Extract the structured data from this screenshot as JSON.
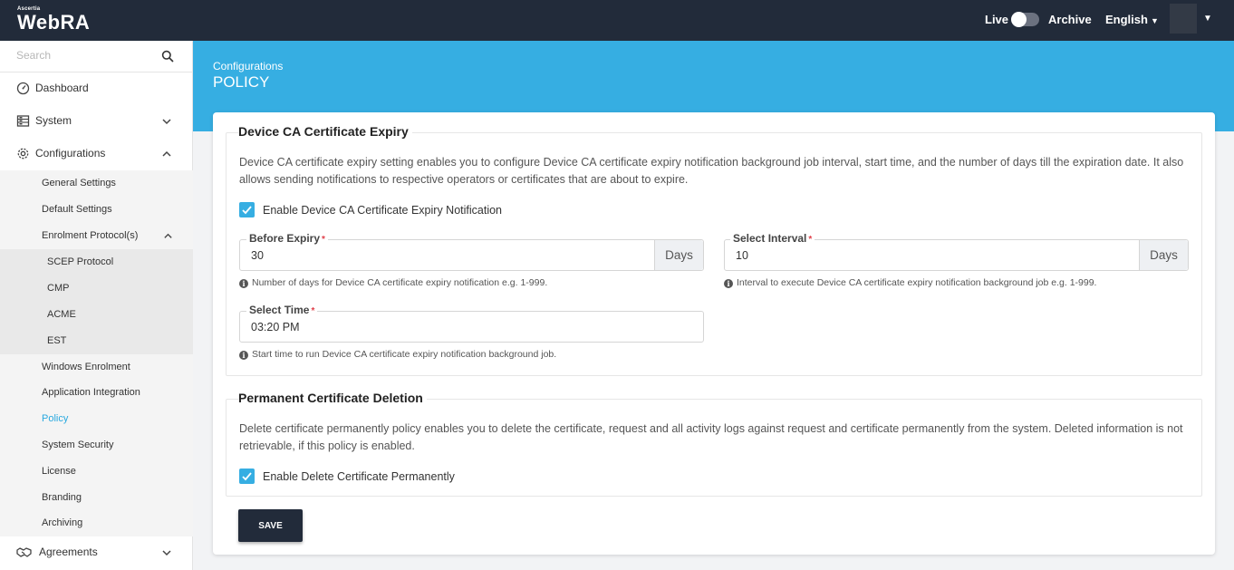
{
  "header": {
    "logo_small": "Ascertia",
    "logo_main": "WebRA",
    "live_label": "Live",
    "archive_label": "Archive",
    "language": "English"
  },
  "sidebar": {
    "search_placeholder": "Search",
    "dashboard": "Dashboard",
    "system": "System",
    "configurations": "Configurations",
    "general_settings": "General Settings",
    "default_settings": "Default Settings",
    "enrolment_protocols": "Enrolment Protocol(s)",
    "scep": "SCEP Protocol",
    "cmp": "CMP",
    "acme": "ACME",
    "est": "EST",
    "windows_enrolment": "Windows Enrolment",
    "application_integration": "Application Integration",
    "policy": "Policy",
    "system_security": "System Security",
    "license": "License",
    "branding": "Branding",
    "archiving": "Archiving",
    "agreements": "Agreements"
  },
  "page": {
    "breadcrumb": "Configurations",
    "title": "POLICY"
  },
  "expiry": {
    "legend": "Device CA Certificate Expiry",
    "description": "Device CA certificate expiry setting enables you to configure Device CA certificate expiry notification background job interval, start time, and the number of days till the expiration date. It also allows sending notifications to respective operators or certificates that are about to expire.",
    "enable_label": "Enable Device CA Certificate Expiry Notification",
    "before_expiry_label": "Before Expiry",
    "before_expiry_value": "30",
    "before_expiry_unit": "Days",
    "before_expiry_hint": "Number of days for Device CA certificate expiry notification e.g. 1-999.",
    "interval_label": "Select Interval",
    "interval_value": "10",
    "interval_unit": "Days",
    "interval_hint": "Interval to execute Device CA certificate expiry notification background job e.g. 1-999.",
    "time_label": "Select Time",
    "time_value": "03:20 PM",
    "time_hint": "Start time to run Device CA certificate expiry notification background job."
  },
  "deletion": {
    "legend": "Permanent Certificate Deletion",
    "description": "Delete certificate permanently policy enables you to delete the certificate, request and all activity logs against request and certificate permanently from the system. Deleted information is not retrievable, if this policy is enabled.",
    "enable_label": "Enable Delete Certificate Permanently"
  },
  "actions": {
    "save": "SAVE"
  },
  "colors": {
    "topbar": "#222b3a",
    "accent": "#36aee2",
    "active_link": "#29a9df"
  }
}
